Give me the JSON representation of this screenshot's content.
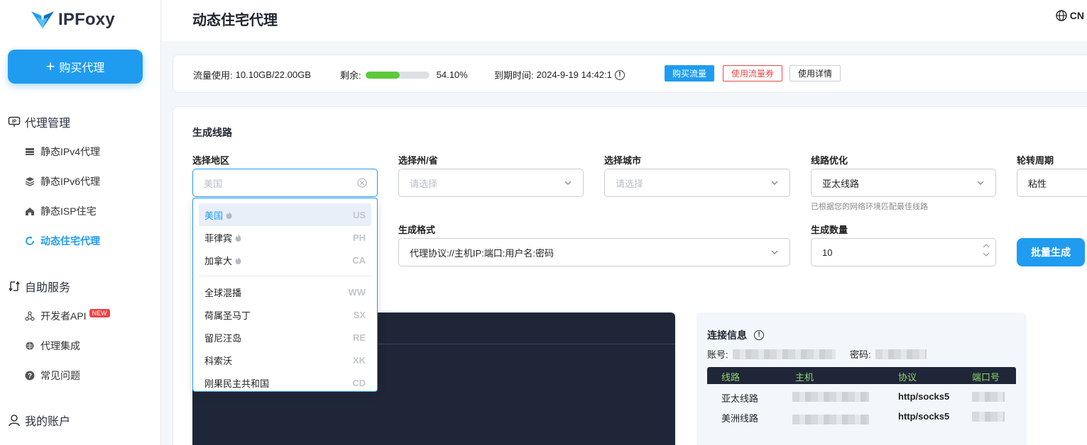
{
  "brand": {
    "name": "IPFoxy"
  },
  "sidebar": {
    "buy_button": "购买代理",
    "groups": [
      {
        "label": "代理管理",
        "items": [
          "静态IPv4代理",
          "静态IPv6代理",
          "静态ISP住宅",
          "动态住宅代理"
        ]
      },
      {
        "label": "自助服务",
        "items": [
          "开发者API",
          "代理集成",
          "常见问题"
        ]
      },
      {
        "label": "我的账户"
      }
    ],
    "new_badge": "NEW",
    "active_item": "动态住宅代理"
  },
  "header": {
    "title": "动态住宅代理",
    "language": "CN"
  },
  "usage": {
    "traffic_label": "流量使用:",
    "traffic_value": "10.10GB/22.00GB",
    "remaining_label": "剩余:",
    "remaining_percent": "54.10%",
    "remaining_fraction": 0.541,
    "expire_label": "到期时间:",
    "expire_value": "2024-9-19 14:42:1",
    "btn_buy": "购买流量",
    "btn_coupon": "使用流量券",
    "btn_detail": "使用详情"
  },
  "generator": {
    "title": "生成线路",
    "region_label": "选择地区",
    "region_placeholder": "美国",
    "state_label": "选择州/省",
    "state_placeholder": "请选择",
    "city_label": "选择城市",
    "city_placeholder": "请选择",
    "route_label": "线路优化",
    "route_value": "亚太线路",
    "route_hint": "已根据您的网络环境匹配最佳线路",
    "rotation_label": "轮转周期",
    "rotation_value": "粘性",
    "format_label": "生成格式",
    "format_value": "代理协议://主机IP:端口:用户名:密码",
    "count_label": "生成数量",
    "count_value": "10",
    "generate_button": "批量生成"
  },
  "dropdown": {
    "items": [
      {
        "name": "美国",
        "code": "US",
        "hot": true,
        "selected": true
      },
      {
        "name": "菲律宾",
        "code": "PH",
        "hot": true
      },
      {
        "name": "加拿大",
        "code": "CA",
        "hot": true
      },
      {
        "name": "全球混播",
        "code": "WW"
      },
      {
        "name": "荷属圣马丁",
        "code": "SX"
      },
      {
        "name": "留尼汪岛",
        "code": "RE"
      },
      {
        "name": "科索沃",
        "code": "XK"
      },
      {
        "name": "刚果民主共和国",
        "code": "CD"
      }
    ]
  },
  "connection": {
    "title": "连接信息",
    "account_label": "账号:",
    "password_label": "密码:",
    "columns": [
      "线路",
      "主机",
      "协议",
      "端口号"
    ],
    "rows": [
      {
        "route": "亚太线路",
        "protocol": "http/socks5"
      },
      {
        "route": "美洲线路",
        "protocol": "http/socks5"
      }
    ]
  },
  "colors": {
    "accent": "#1f9cf0",
    "danger": "#e84a4a",
    "progress": "#5cc93b",
    "dark_panel": "#1f2638",
    "table_header_text": "#8fd36a"
  }
}
